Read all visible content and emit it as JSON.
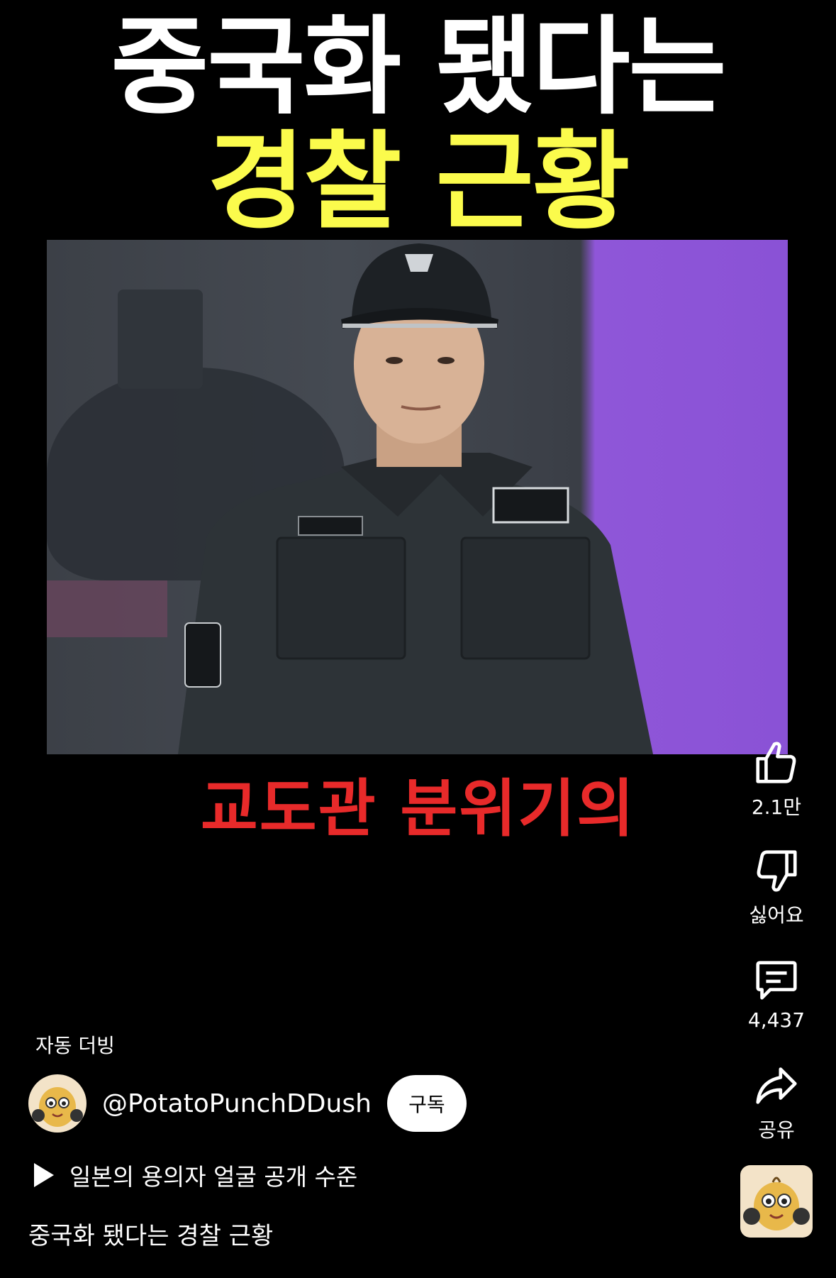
{
  "overlay": {
    "headline_line1": "중국화 됐다는",
    "headline_line2": "경찰 근황",
    "caption": "교도관 분위기의",
    "colors": {
      "headline_white": "#ffffff",
      "headline_yellow": "#fbfb4c",
      "caption_red": "#e82a2a"
    }
  },
  "actions": {
    "like": {
      "icon": "thumbs-up-icon",
      "label": "2.1만"
    },
    "dislike": {
      "icon": "thumbs-down-icon",
      "label": "싫어요"
    },
    "comments": {
      "icon": "comment-icon",
      "label": "4,437"
    },
    "share": {
      "icon": "share-icon",
      "label": "공유"
    }
  },
  "dubbing_label": "자동 더빙",
  "channel": {
    "handle": "@PotatoPunchDDush",
    "subscribe_label": "구독"
  },
  "related_video": {
    "title": "일본의 용의자 얼굴 공개 수준"
  },
  "video_title": "중국화 됐다는 경찰 근황"
}
